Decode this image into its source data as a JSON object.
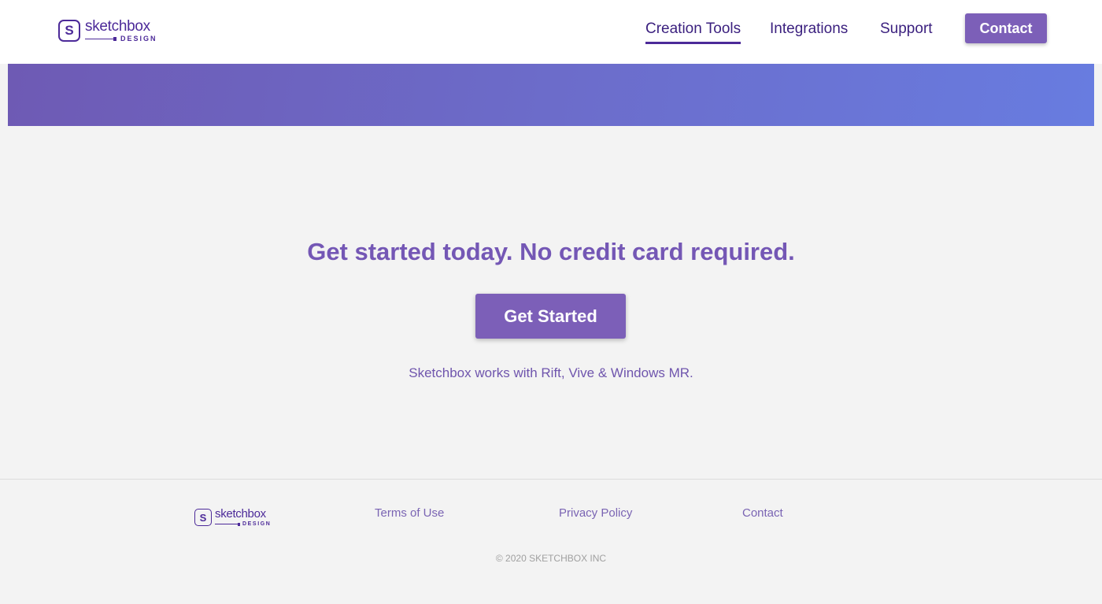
{
  "brand": {
    "mark": "S",
    "name": "sketchbox",
    "sub": "DESIGN"
  },
  "header": {
    "nav": [
      {
        "label": "Creation Tools",
        "active": true
      },
      {
        "label": "Integrations",
        "active": false
      },
      {
        "label": "Support",
        "active": false
      }
    ],
    "contact_label": "Contact"
  },
  "cta": {
    "heading": "Get started today. No credit card required.",
    "button_label": "Get Started",
    "note": "Sketchbox works with Rift, Vive & Windows MR."
  },
  "footer": {
    "links": [
      {
        "label": "Terms of Use"
      },
      {
        "label": "Privacy Policy"
      },
      {
        "label": "Contact"
      }
    ],
    "copyright": "© 2020 SKETCHBOX INC"
  },
  "colors": {
    "brand_purple": "#4c2a99",
    "button_purple": "#7c5fb8",
    "heading_purple": "#7457b5",
    "banner_start": "#6e5ab4",
    "banner_end": "#687ce0",
    "background": "#f3f3f3"
  }
}
